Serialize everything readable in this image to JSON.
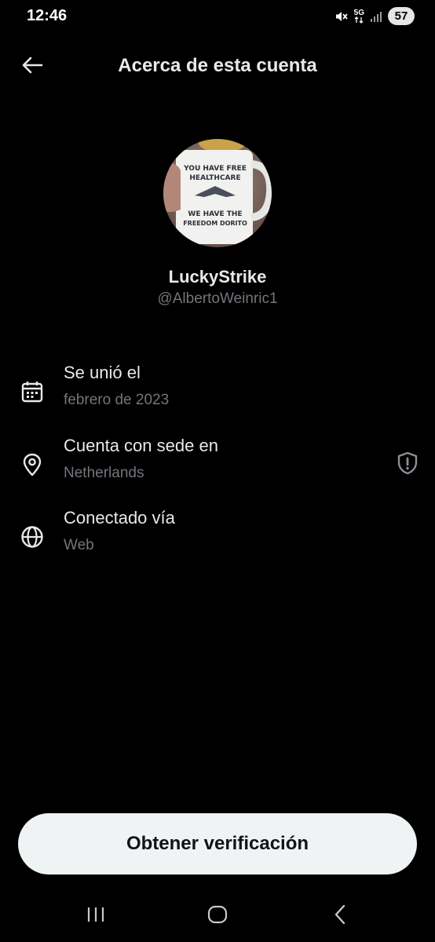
{
  "status_bar": {
    "time": "12:46",
    "network": "5G",
    "battery": "57",
    "icons": [
      "mute-icon",
      "network-5g-icon",
      "signal-icon",
      "battery-icon"
    ]
  },
  "header": {
    "title": "Acerca de esta cuenta",
    "back_icon": "arrow-left-icon"
  },
  "profile": {
    "display_name": "LuckyStrike",
    "handle": "@AlbertoWeinric1",
    "avatar_text": {
      "line1": "YOU HAVE FREE",
      "line2": "HEALTHCARE",
      "line3": "WE HAVE THE",
      "line4": "FREEDOM DORITO"
    }
  },
  "details": [
    {
      "icon": "calendar-icon",
      "title": "Se unió el",
      "value": "febrero de 2023"
    },
    {
      "icon": "location-pin-icon",
      "title": "Cuenta con sede en",
      "value": "Netherlands",
      "extra_icon": "shield-alert-icon"
    },
    {
      "icon": "globe-icon",
      "title": "Conectado vía",
      "value": "Web"
    }
  ],
  "cta": {
    "label": "Obtener verificación"
  },
  "nav": {
    "items": [
      "recent-apps-icon",
      "home-icon",
      "back-icon"
    ]
  },
  "colors": {
    "background": "#000000",
    "primary_text": "#e7e9ea",
    "secondary_text": "#71767b",
    "button_bg": "#eff3f4",
    "button_text": "#0f1419"
  }
}
